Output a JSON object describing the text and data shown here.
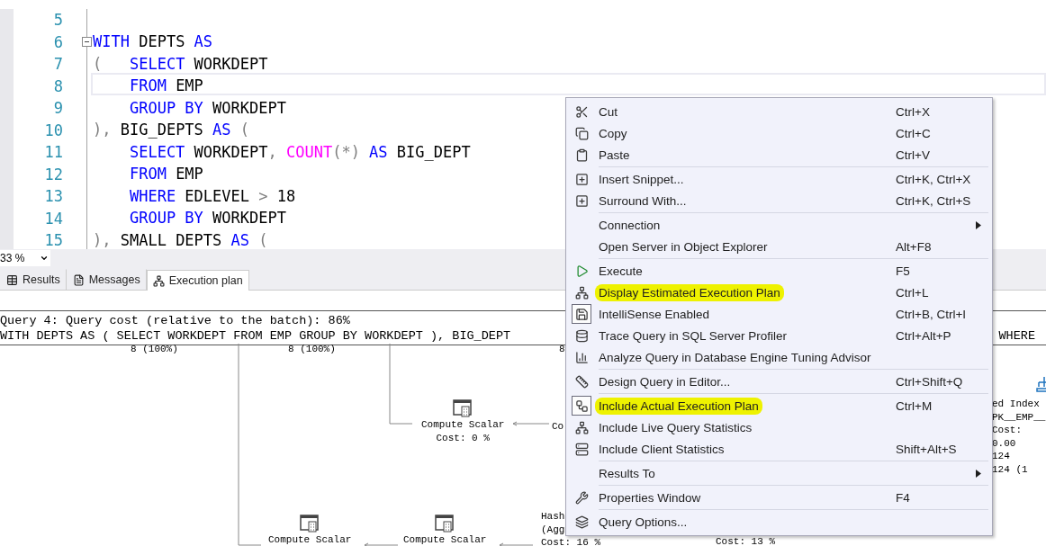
{
  "editor": {
    "lines": [
      {
        "number": "5",
        "current": false,
        "collapsible": false
      },
      {
        "number": "6",
        "current": false,
        "collapsible": true,
        "tokens": [
          {
            "kind": "keyword",
            "text": "WITH"
          },
          {
            "kind": "ident",
            "text": " DEPTS "
          },
          {
            "kind": "keyword",
            "text": "AS"
          }
        ]
      },
      {
        "number": "7",
        "current": false,
        "collapsible": false,
        "tokens": [
          {
            "kind": "punct",
            "text": "(   "
          },
          {
            "kind": "keyword",
            "text": "SELECT"
          },
          {
            "kind": "ident",
            "text": " WORKDEPT"
          }
        ]
      },
      {
        "number": "8",
        "current": true,
        "collapsible": false,
        "tokens": [
          {
            "kind": "keyword",
            "text": "    FROM"
          },
          {
            "kind": "ident",
            "text": " EMP"
          }
        ]
      },
      {
        "number": "9",
        "current": false,
        "collapsible": false,
        "tokens": [
          {
            "kind": "keyword",
            "text": "    GROUP BY"
          },
          {
            "kind": "ident",
            "text": " WORKDEPT"
          }
        ]
      },
      {
        "number": "10",
        "current": false,
        "collapsible": false,
        "tokens": [
          {
            "kind": "punct",
            "text": "), "
          },
          {
            "kind": "ident",
            "text": "BIG_DEPTS "
          },
          {
            "kind": "keyword",
            "text": "AS"
          },
          {
            "kind": "punct",
            "text": " ("
          }
        ]
      },
      {
        "number": "11",
        "current": false,
        "collapsible": false,
        "tokens": [
          {
            "kind": "keyword",
            "text": "    SELECT"
          },
          {
            "kind": "ident",
            "text": " WORKDEPT"
          },
          {
            "kind": "punct",
            "text": ", "
          },
          {
            "kind": "function",
            "text": "COUNT"
          },
          {
            "kind": "punct",
            "text": "(*) "
          },
          {
            "kind": "keyword",
            "text": "AS"
          },
          {
            "kind": "ident",
            "text": " BIG_DEPT"
          }
        ]
      },
      {
        "number": "12",
        "current": false,
        "collapsible": false,
        "tokens": [
          {
            "kind": "keyword",
            "text": "    FROM"
          },
          {
            "kind": "ident",
            "text": " EMP"
          }
        ]
      },
      {
        "number": "13",
        "current": false,
        "collapsible": false,
        "tokens": [
          {
            "kind": "keyword",
            "text": "    WHERE"
          },
          {
            "kind": "ident",
            "text": " EDLEVEL "
          },
          {
            "kind": "punct",
            "text": ">"
          },
          {
            "kind": "ident",
            "text": " 18"
          }
        ]
      },
      {
        "number": "14",
        "current": false,
        "collapsible": false,
        "tokens": [
          {
            "kind": "keyword",
            "text": "    GROUP BY"
          },
          {
            "kind": "ident",
            "text": " WORKDEPT"
          }
        ]
      },
      {
        "number": "15",
        "current": false,
        "collapsible": false,
        "tokens": [
          {
            "kind": "punct",
            "text": "), "
          },
          {
            "kind": "ident",
            "text": "SMALL DEPTS "
          },
          {
            "kind": "keyword",
            "text": "AS"
          },
          {
            "kind": "punct",
            "text": " ("
          }
        ]
      }
    ],
    "zoom": "33 %"
  },
  "tabs": [
    {
      "label": "Results",
      "selected": false
    },
    {
      "label": "Messages",
      "selected": false
    },
    {
      "label": "Execution plan",
      "selected": true
    }
  ],
  "plan": {
    "title": "Query 4: Query cost (relative to the batch): 86%",
    "statement": "WITH DEPTS AS ( SELECT WORKDEPT FROM EMP GROUP BY WORKDEPT ), BIG_DEPT",
    "statement_end": "WHERE",
    "items": [
      {
        "kind": "label",
        "lines": [
          "8 (100%)"
        ]
      },
      {
        "kind": "label",
        "lines": [
          "8 (100%)"
        ]
      },
      {
        "kind": "label",
        "lines": [
          "8"
        ]
      },
      {
        "kind": "scalar",
        "lines": [
          "Compute Scalar",
          "Cost: 0 %"
        ]
      },
      {
        "kind": "label",
        "lines": [
          "Co"
        ]
      },
      {
        "kind": "scalar",
        "lines": [
          "Compute Scalar"
        ]
      },
      {
        "kind": "scalar",
        "lines": [
          "Compute Scalar"
        ]
      },
      {
        "kind": "label",
        "lines": [
          "Hash",
          "(Agg",
          "Cost: 16 %"
        ]
      },
      {
        "kind": "label",
        "lines": [
          "Cost: 13 %"
        ]
      },
      {
        "kind": "index",
        "lines": [
          "ed Index",
          "PK__EMP__",
          "Cost:",
          "0.00",
          "124",
          "124 (1"
        ]
      }
    ]
  },
  "context_menu": {
    "groups": [
      [
        {
          "label": "Cut",
          "shortcut": "Ctrl+X",
          "highlighted": false,
          "checked": false
        },
        {
          "label": "Copy",
          "shortcut": "Ctrl+C",
          "highlighted": false,
          "checked": false
        },
        {
          "label": "Paste",
          "shortcut": "Ctrl+V",
          "highlighted": false,
          "checked": false
        }
      ],
      [
        {
          "label": "Insert Snippet...",
          "shortcut": "Ctrl+K, Ctrl+X",
          "highlighted": false,
          "checked": false
        },
        {
          "label": "Surround With...",
          "shortcut": "Ctrl+K, Ctrl+S",
          "highlighted": false,
          "checked": false
        }
      ],
      [
        {
          "label": "Connection",
          "submenu": true,
          "highlighted": false,
          "checked": false
        },
        {
          "label": "Open Server in Object Explorer",
          "shortcut": "Alt+F8",
          "highlighted": false,
          "checked": false
        }
      ],
      [
        {
          "label": "Execute",
          "shortcut": "F5",
          "highlighted": false,
          "checked": false
        },
        {
          "label": "Display Estimated Execution Plan",
          "shortcut": "Ctrl+L",
          "highlighted": true,
          "checked": false
        },
        {
          "label": "IntelliSense Enabled",
          "shortcut": "Ctrl+B, Ctrl+I",
          "highlighted": false,
          "checked": true
        },
        {
          "label": "Trace Query in SQL Server Profiler",
          "shortcut": "Ctrl+Alt+P",
          "highlighted": false,
          "checked": false
        },
        {
          "label": "Analyze Query in Database Engine Tuning Advisor",
          "highlighted": false,
          "checked": false
        }
      ],
      [
        {
          "label": "Design Query in Editor...",
          "shortcut": "Ctrl+Shift+Q",
          "highlighted": false,
          "checked": false
        }
      ],
      [
        {
          "label": "Include Actual Execution Plan",
          "shortcut": "Ctrl+M",
          "highlighted": true,
          "checked": true
        },
        {
          "label": "Include Live Query Statistics",
          "highlighted": false,
          "checked": false
        },
        {
          "label": "Include Client Statistics",
          "shortcut": "Shift+Alt+S",
          "highlighted": false,
          "checked": false
        }
      ],
      [
        {
          "label": "Results To",
          "submenu": true,
          "highlighted": false,
          "checked": false
        }
      ],
      [
        {
          "label": "Properties Window",
          "shortcut": "F4",
          "highlighted": false,
          "checked": false
        }
      ],
      [
        {
          "label": "Query Options...",
          "highlighted": false,
          "checked": false
        }
      ]
    ]
  }
}
